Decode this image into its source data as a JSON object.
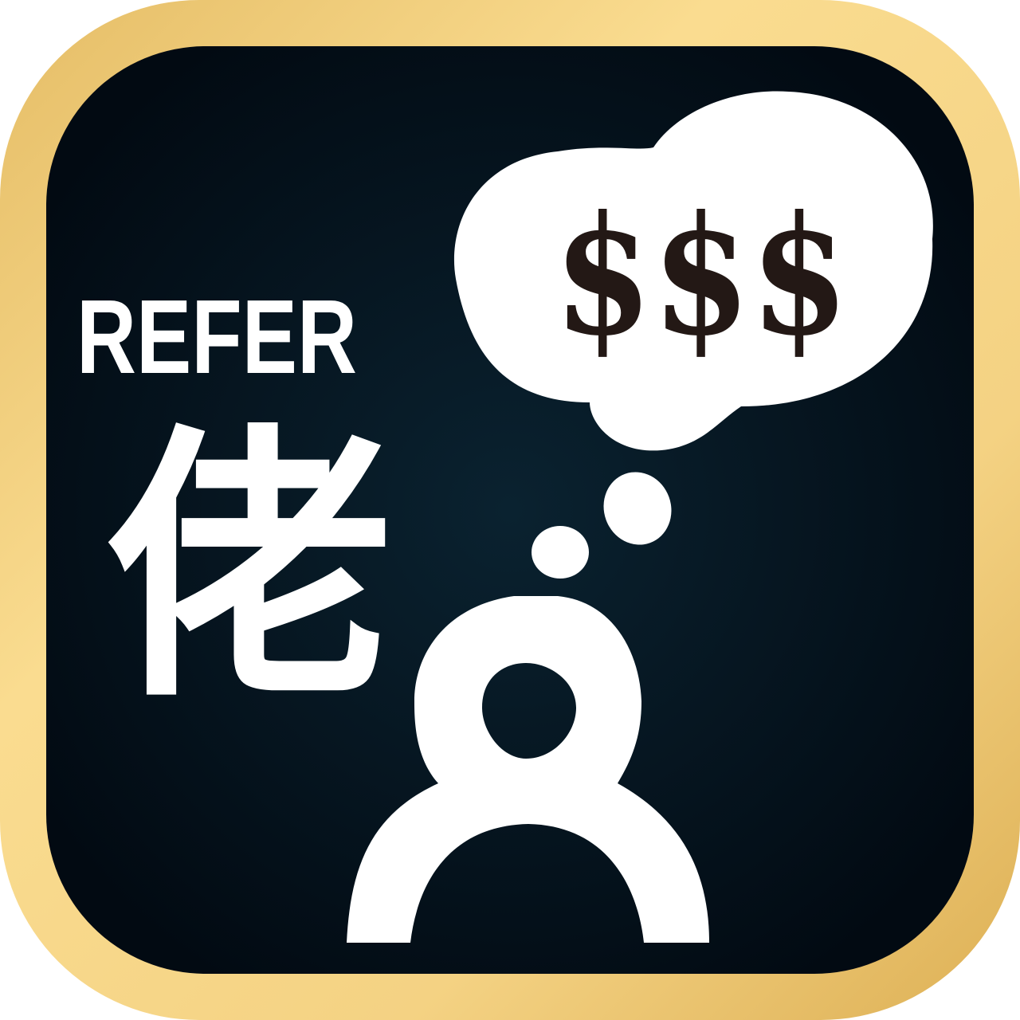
{
  "icon": {
    "refer_label": "REFER",
    "character": "佬",
    "thought_text": "$$$",
    "colors": {
      "frame_light": "#FADC90",
      "frame_dark": "#E2B65A",
      "background_center": "#0A2230",
      "background_edge": "#020A12",
      "foreground": "#FFFFFF",
      "money": "#231815"
    },
    "icons": {
      "person": "person-icon",
      "thought_bubble": "thought-bubble-icon"
    }
  }
}
